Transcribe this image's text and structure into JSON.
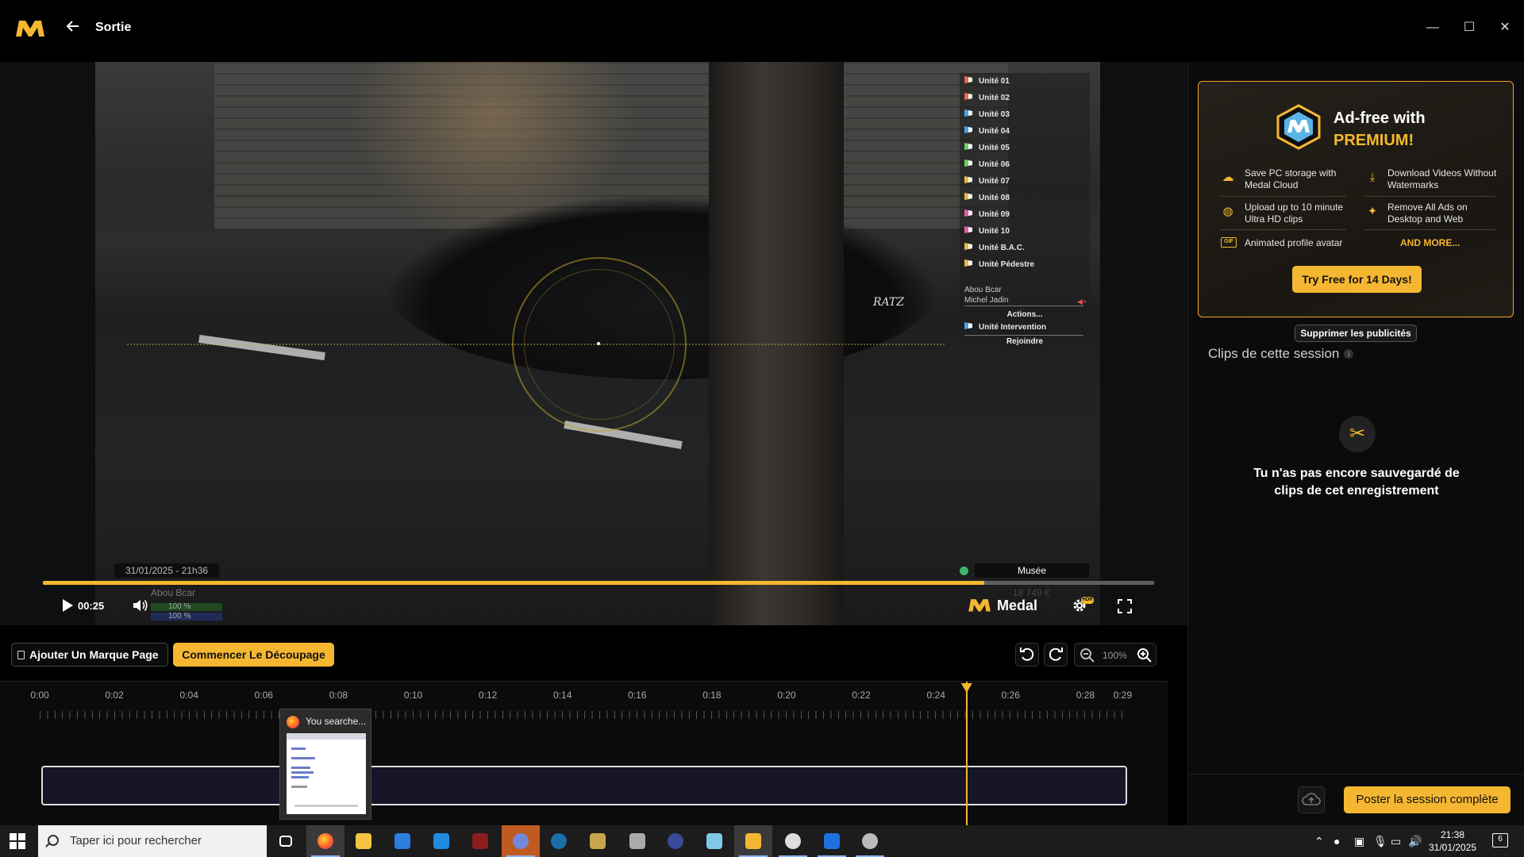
{
  "window": {
    "title": "Sortie",
    "controls": {
      "minimize": "—",
      "maximize": "☐",
      "close": "✕"
    }
  },
  "video": {
    "radio_menu": {
      "units": [
        {
          "label": "Unité 01",
          "color": "red"
        },
        {
          "label": "Unité 02",
          "color": "red"
        },
        {
          "label": "Unité 03",
          "color": "blue"
        },
        {
          "label": "Unité 04",
          "color": "blue"
        },
        {
          "label": "Unité 05",
          "color": "green"
        },
        {
          "label": "Unité 06",
          "color": "green"
        },
        {
          "label": "Unité 07",
          "color": "gold"
        },
        {
          "label": "Unité 08",
          "color": "gold"
        },
        {
          "label": "Unité 09",
          "color": "pink"
        },
        {
          "label": "Unité 10",
          "color": "pink"
        },
        {
          "label": "Unité B.A.C.",
          "color": "gold"
        },
        {
          "label": "Unité Pédestre",
          "color": "gold"
        }
      ],
      "members": [
        "Abou Bcar",
        "Michel Jadin"
      ],
      "actions_label": "Actions...",
      "intervention_label": "Unité Intervention",
      "join_label": "Rejoindre"
    },
    "plate_text": "RATZ",
    "hud": {
      "date": "31/01/2025 - 21h36",
      "player_name": "Abou Bcar",
      "health": "100 %",
      "armor": "100 %",
      "location": "Musée",
      "money": "18 749 €"
    }
  },
  "player": {
    "progress": 0.847,
    "current_time": "00:25",
    "brand": "Medal",
    "hdr_badge": "HDR"
  },
  "editor": {
    "bookmark_label": "Ajouter Un Marque Page",
    "trim_label": "Commencer Le Découpage",
    "zoom_level": "100%"
  },
  "timeline": {
    "ticks": [
      "0:00",
      "0:02",
      "0:04",
      "0:06",
      "0:08",
      "0:10",
      "0:12",
      "0:14",
      "0:16",
      "0:18",
      "0:20",
      "0:22",
      "0:24",
      "0:26",
      "0:28",
      "0:29"
    ],
    "playhead_time": 24.8
  },
  "thumbnail_popup": {
    "title": "You searche..."
  },
  "right_panel": {
    "premium": {
      "title_line1": "Ad-free with",
      "title_line2": "PREMIUM!",
      "features": [
        "Save PC storage with Medal Cloud",
        "Download Videos Without Watermarks",
        "Upload up to 10 minute Ultra HD clips",
        "Remove All Ads on Desktop and Web",
        "Animated profile avatar"
      ],
      "gif_badge": "GIF",
      "more_label": "AND MORE...",
      "cta_label": "Try Free for 14 Days!"
    },
    "remove_ads_label": "Supprimer les publicités",
    "clips_heading": "Clips de cette session",
    "empty_message": "Tu n'as pas encore sauvegardé de clips de cet enregistrement",
    "post_label": "Poster la session complète"
  },
  "taskbar": {
    "search_placeholder": "Taper ici pour rechercher",
    "time": "21:38",
    "date": "31/01/2025",
    "notification_count": "6"
  }
}
